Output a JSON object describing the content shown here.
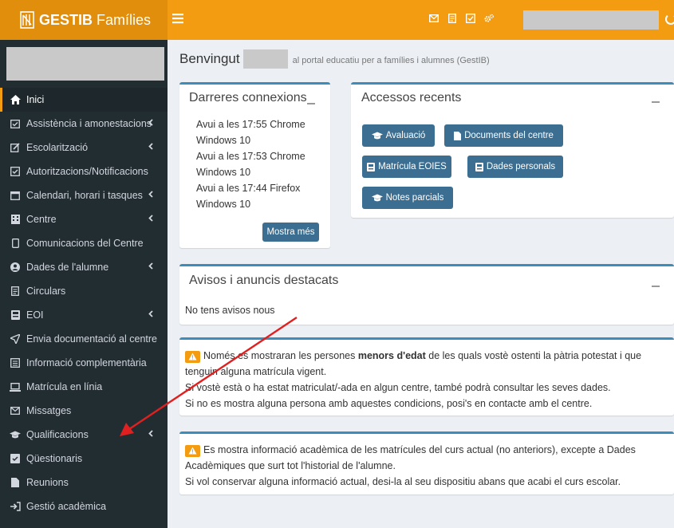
{
  "header": {
    "logo_text": "GESTIB",
    "logo_suffix": "Famílies",
    "menu_toggle": "≡"
  },
  "sidebar": {
    "items": [
      {
        "label": "Inici",
        "icon": "home-icon",
        "chevron": false,
        "active": true
      },
      {
        "label": "Assistència i amonestacions",
        "icon": "calendar-check-icon",
        "chevron": true
      },
      {
        "label": "Escolarització",
        "icon": "edit-icon",
        "chevron": true
      },
      {
        "label": "Autoritzacions/Notificacions",
        "icon": "check-square-icon",
        "chevron": false
      },
      {
        "label": "Calendari, horari i tasques",
        "icon": "calendar-icon",
        "chevron": true
      },
      {
        "label": "Centre",
        "icon": "building-icon",
        "chevron": true
      },
      {
        "label": "Comunicacions del Centre",
        "icon": "mobile-icon",
        "chevron": false
      },
      {
        "label": "Dades de l'alumne",
        "icon": "user-circle-icon",
        "chevron": true
      },
      {
        "label": "Circulars",
        "icon": "file-text-icon",
        "chevron": false
      },
      {
        "label": "EOI",
        "icon": "id-card-icon",
        "chevron": true
      },
      {
        "label": "Envia documentació al centre",
        "icon": "send-icon",
        "chevron": false
      },
      {
        "label": "Informació complementària",
        "icon": "list-alt-icon",
        "chevron": false
      },
      {
        "label": "Matrícula en línia",
        "icon": "laptop-icon",
        "chevron": false
      },
      {
        "label": "Missatges",
        "icon": "envelope-icon",
        "chevron": false
      },
      {
        "label": "Qualificacions",
        "icon": "graduation-cap-icon",
        "chevron": true
      },
      {
        "label": "Qüestionaris",
        "icon": "check-box-icon",
        "chevron": false
      },
      {
        "label": "Reunions",
        "icon": "file-icon",
        "chevron": false
      },
      {
        "label": "Gestió acadèmica",
        "icon": "sign-in-icon",
        "chevron": false
      }
    ]
  },
  "welcome": {
    "title": "Benvingut",
    "subtitle": "al portal educatiu per a famílies i alumnes (GestIB)"
  },
  "connections": {
    "title": "Darreres connexions",
    "lines": [
      "Avui a les 17:55 Chrome",
      "Windows 10",
      "Avui a les 17:53 Chrome",
      "Windows 10",
      "Avui a les 17:44 Firefox",
      "Windows 10"
    ],
    "more_button": "Mostra més"
  },
  "recent": {
    "title": "Accessos recents",
    "buttons": [
      {
        "label": "Avaluació",
        "icon": "graduation-cap-icon"
      },
      {
        "label": "Documents del centre",
        "icon": "file-icon"
      },
      {
        "label": "Matrícula EOIES",
        "icon": "id-card-icon"
      },
      {
        "label": "Dades personals",
        "icon": "id-card-icon"
      },
      {
        "label": "Notes parcials",
        "icon": "graduation-cap-icon"
      }
    ]
  },
  "notices": {
    "title": "Avisos i anuncis destacats",
    "empty_text": "No tens avisos nous"
  },
  "alert1": {
    "line1_a": "Només es mostraran les persones ",
    "line1_bold": "menors d'edat",
    "line1_b": " de les quals vostè ostenti la pàtria potestat i que",
    "line2": "tenguin alguna matrícula vigent.",
    "line3": "Si vostè està o ha estat matriculat/-ada en algun centre, també podrà consultar les seves dades.",
    "line4": "Si no es mostra alguna persona amb aquestes condicions, posi's en contacte amb el centre."
  },
  "alert2": {
    "line1": "Es mostra informació acadèmica de les matrícules del curs actual (no anteriors), excepte a Dades",
    "line2": "Acadèmiques que surt tot l'historial de l'alumne.",
    "line3": "Si vol conservar alguna informació actual, desi-la al seu dispositiu abans que acabi el curs escolar."
  },
  "colors": {
    "header": "#f39c12",
    "sidebar": "#222d32",
    "button": "#3c6e91",
    "box_border": "#3c8dbc",
    "arrow": "#e02020"
  }
}
